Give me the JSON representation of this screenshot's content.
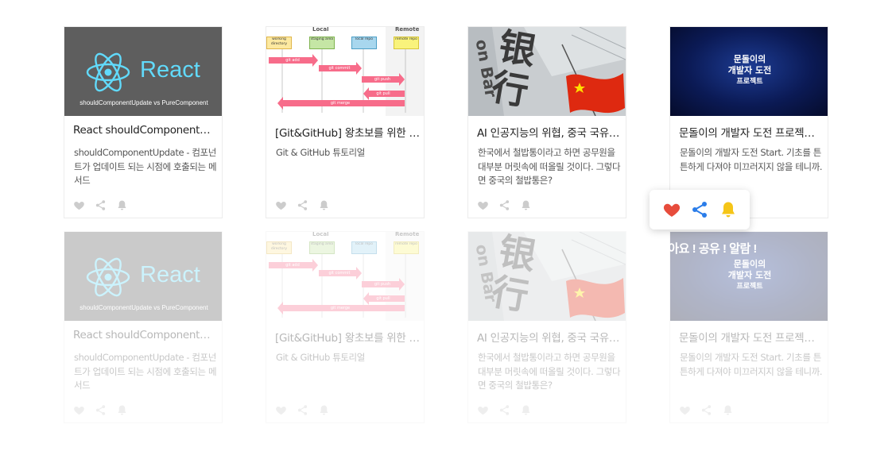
{
  "colors": {
    "icon_muted": "#cccccc",
    "heart_active": "#e74c3c",
    "share_active": "#2b7de9",
    "bell_active": "#f5c518",
    "react_blue": "#61dafb",
    "title_text": "#222222",
    "desc_text": "#555555"
  },
  "cards": [
    {
      "thumb_type": "react",
      "thumb_word": "React",
      "thumb_caption": "shouldComponentUpdate vs PureComponent",
      "title": "React shouldComponentUpdate vs PureComponent",
      "desc": "shouldComponentUpdate - 컴포넌트가 업데이트 되는 시점에 호출되는 메서드"
    },
    {
      "thumb_type": "git",
      "thumb_heading_local": "Local",
      "thumb_heading_remote": "Remote",
      "thumb_boxes": [
        "working directory",
        "staging area",
        "local repo",
        "remote repo"
      ],
      "thumb_arrows": [
        "git add",
        "git commit",
        "git push",
        "git pull",
        "git merge"
      ],
      "title": "[Git&GitHub] 왕초보를 위한 깃&깃허브",
      "desc": "Git & GitHub 튜토리얼"
    },
    {
      "thumb_type": "bank",
      "thumb_chars": "银行",
      "thumb_side": "on Bar",
      "title": "AI 인공지능의 위협, 중국 국유은행의 철밥통",
      "desc": "한국에서 철밥통이라고 하면 공무원을 대부분 머릿속에 떠올릴 것이다. 그렇다면 중국의 철밥통은?"
    },
    {
      "thumb_type": "dev",
      "thumb_lines": [
        "문돌이의",
        "개발자 도전",
        "프로젝트"
      ],
      "title": "문돌이의 개발자 도전 프로젝트 Start",
      "desc": "문돌이의 개발자 도전 Start. 기초를 튼튼하게 다져야 미끄러지지 않을 테니까."
    }
  ],
  "popup": {
    "icons": [
      "heart-icon",
      "share-icon",
      "bell-icon"
    ],
    "caption": "좋아요 ! 공유 ! 알람 !"
  }
}
